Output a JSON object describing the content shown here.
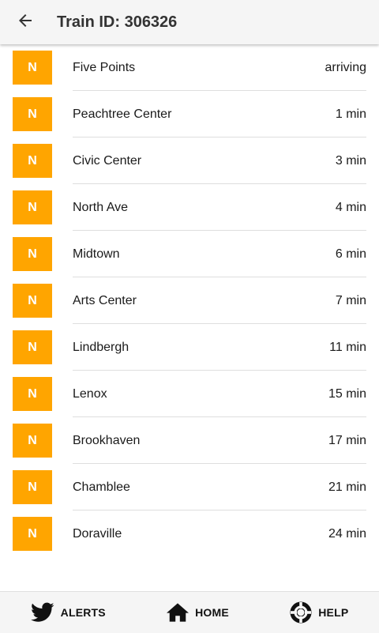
{
  "header": {
    "title": "Train ID: 306326",
    "back_icon": "arrow-left-icon"
  },
  "line_color": "#ffa500",
  "stops": [
    {
      "badge": "N",
      "station": "Five Points",
      "eta": "arriving"
    },
    {
      "badge": "N",
      "station": "Peachtree Center",
      "eta": "1 min"
    },
    {
      "badge": "N",
      "station": "Civic Center",
      "eta": "3 min"
    },
    {
      "badge": "N",
      "station": "North Ave",
      "eta": "4 min"
    },
    {
      "badge": "N",
      "station": "Midtown",
      "eta": "6 min"
    },
    {
      "badge": "N",
      "station": "Arts Center",
      "eta": "7 min"
    },
    {
      "badge": "N",
      "station": "Lindbergh",
      "eta": "11 min"
    },
    {
      "badge": "N",
      "station": "Lenox",
      "eta": "15 min"
    },
    {
      "badge": "N",
      "station": "Brookhaven",
      "eta": "17 min"
    },
    {
      "badge": "N",
      "station": "Chamblee",
      "eta": "21 min"
    },
    {
      "badge": "N",
      "station": "Doraville",
      "eta": "24 min"
    }
  ],
  "bottom_nav": {
    "alerts": {
      "label": "ALERTS",
      "icon": "twitter-bird-icon"
    },
    "home": {
      "label": "HOME",
      "icon": "home-icon"
    },
    "help": {
      "label": "HELP",
      "icon": "lifebuoy-icon"
    }
  }
}
